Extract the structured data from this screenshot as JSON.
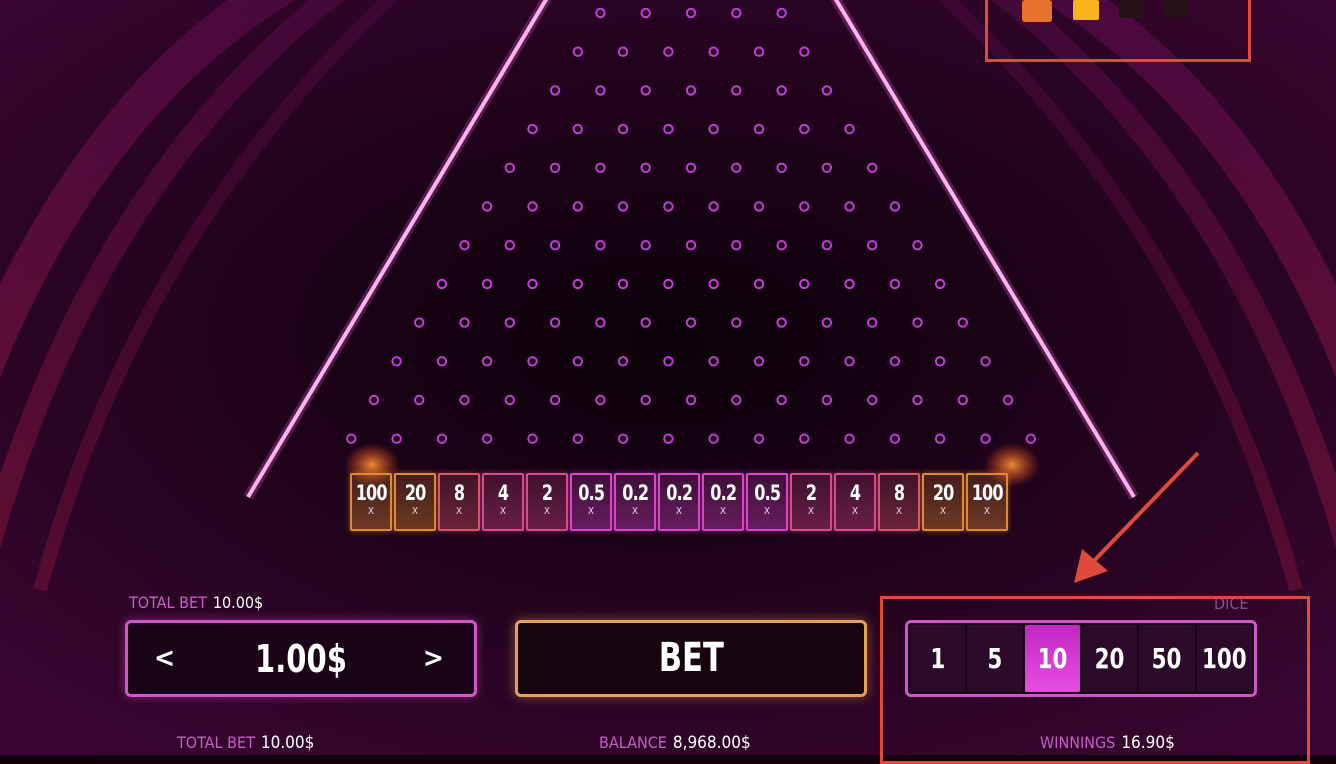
{
  "game": {
    "multipliers": [
      "100",
      "20",
      "8",
      "4",
      "2",
      "0.5",
      "0.2",
      "0.2",
      "0.2",
      "0.5",
      "2",
      "4",
      "8",
      "20",
      "100"
    ],
    "multiplier_suffix": "X",
    "slot_colors": [
      "#e08a2e",
      "#e08a2e",
      "#d8556b",
      "#d94a8a",
      "#d94a8a",
      "#d945c9",
      "#d945c9",
      "#d945c9",
      "#d945c9",
      "#d945c9",
      "#d94a8a",
      "#d94a8a",
      "#d8556b",
      "#e08a2e",
      "#e08a2e"
    ]
  },
  "bet_panel": {
    "total_bet_label": "TOTAL BET",
    "total_bet_value": "10.00$",
    "amount": "1.00$",
    "prev_label": "<",
    "next_label": ">"
  },
  "bet_button": {
    "label": "BET"
  },
  "dice_panel": {
    "label": "DICE",
    "options": [
      "1",
      "5",
      "10",
      "20",
      "50",
      "100"
    ],
    "selected": "10"
  },
  "footer": {
    "total_bet_label": "TOTAL BET",
    "total_bet_value": "10.00$",
    "balance_label": "BALANCE",
    "balance_value": "8,968.00$",
    "winnings_label": "WINNINGS",
    "winnings_value": "16.90$"
  },
  "colors": {
    "accent_pink": "#d455c9",
    "accent_orange": "#e7a05a",
    "annotation_red": "#e04a3c"
  }
}
